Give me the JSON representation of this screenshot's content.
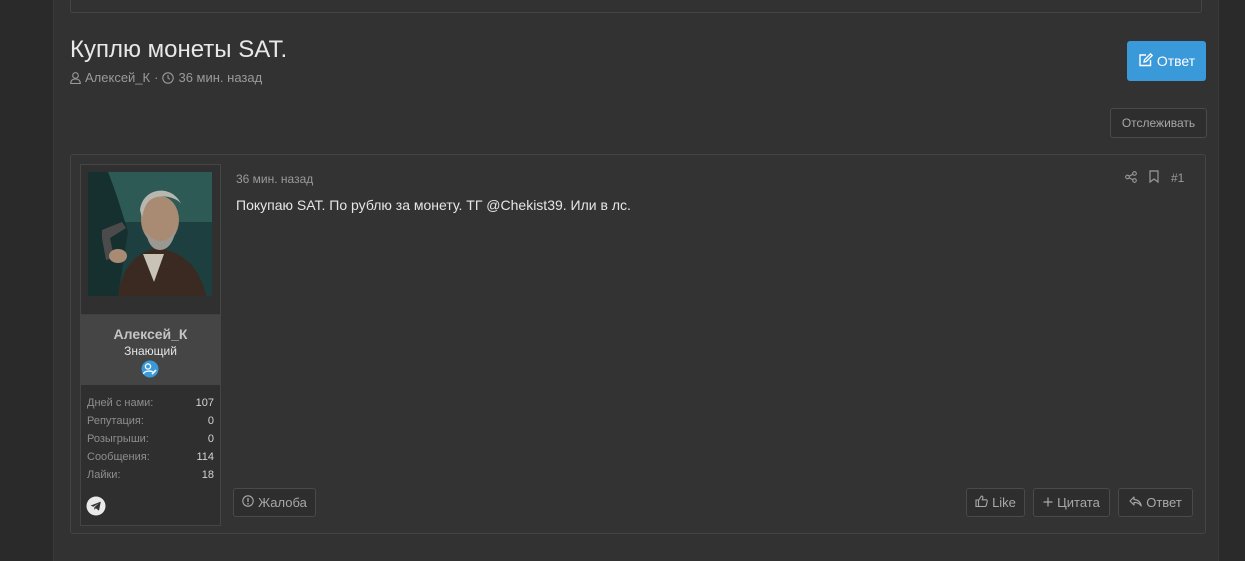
{
  "thread": {
    "title": "Куплю монеты SAT.",
    "author": "Алексей_К",
    "separator": "·",
    "time": "36 мин. назад",
    "reply_button": "Ответ",
    "watch_button": "Отслеживать"
  },
  "post": {
    "date": "36 мин. назад",
    "number": "#1",
    "text": "Покупаю SAT. По рублю за монету. ТГ @Chekist39. Или в лс.",
    "actions": {
      "report": "Жалоба",
      "like": "Like",
      "quote": "Цитата",
      "reply": "Ответ"
    }
  },
  "user": {
    "name": "Алексей_К",
    "title": "Знающий",
    "stats": [
      {
        "label": "Дней с нами:",
        "value": "107"
      },
      {
        "label": "Репутация:",
        "value": "0"
      },
      {
        "label": "Розыгрыши:",
        "value": "0"
      },
      {
        "label": "Сообщения:",
        "value": "114"
      },
      {
        "label": "Лайки:",
        "value": "18"
      }
    ]
  },
  "icons": {
    "user": "user-icon",
    "clock": "clock-icon",
    "edit": "edit-icon",
    "share": "share-icon",
    "bookmark": "bookmark-icon",
    "badge": "user-edit-badge-icon",
    "telegram": "telegram-icon",
    "report": "report-icon",
    "like": "thumbs-up-icon",
    "quote": "plus-icon",
    "reply": "reply-icon"
  },
  "colors": {
    "accent": "#3a9ad9",
    "background": "#2a2a2a",
    "panel": "#323232"
  }
}
